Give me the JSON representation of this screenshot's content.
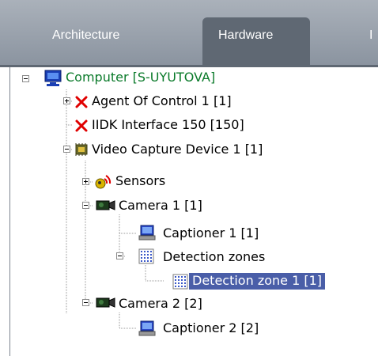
{
  "tabs": {
    "architecture": "Architecture",
    "hardware": "Hardware",
    "next": "I"
  },
  "tree": {
    "computer": "Computer [S-UYUTOVA]",
    "agent": "Agent Of Control 1 [1]",
    "iidk": "IIDK Interface 150 [150]",
    "vcd": "Video Capture Device 1 [1]",
    "sensors": "Sensors",
    "camera1": "Camera 1 [1]",
    "captioner1": "Captioner 1 [1]",
    "zones": "Detection zones",
    "zone1": "Detection zone 1 [1]",
    "camera2": "Camera 2 [2]",
    "captioner2": "Captioner 2 [2]"
  },
  "colors": {
    "selection": "#4a5ea8",
    "computer_text": "#0a7a2a",
    "error_x": "#e00000"
  }
}
